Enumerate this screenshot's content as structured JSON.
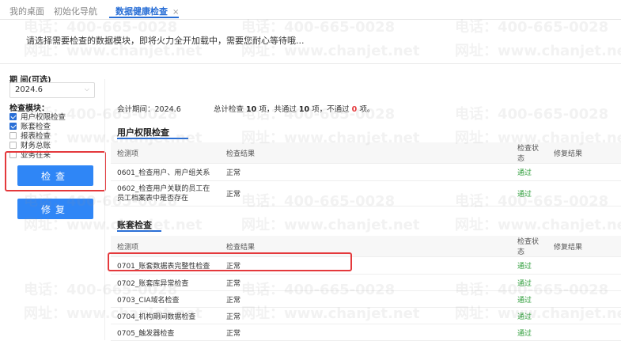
{
  "tabs": [
    {
      "label": "我的桌面"
    },
    {
      "label": "初始化导航"
    },
    {
      "label": "数据健康检查",
      "close": "×"
    }
  ],
  "instruction": "请选择需要检查的数据模块，即将火力全开加载中，需要您耐心等待哦...",
  "left": {
    "period_label": "期 间(可选)",
    "period_value": "2024.6",
    "module_label": "检查模块：",
    "modules": [
      {
        "label": "用户权限检查",
        "checked": true
      },
      {
        "label": "账套检查",
        "checked": true
      },
      {
        "label": "报表检查",
        "checked": false
      },
      {
        "label": "财务总账",
        "checked": false
      },
      {
        "label": "业务往来",
        "checked": false
      }
    ],
    "check_button": "检查",
    "repair_button": "修复"
  },
  "summary": {
    "period": "会计期间：2024.6",
    "p1": "总计检查",
    "total": "10",
    "p2": "项，共通过",
    "passed": "10",
    "p3": "项，不通过",
    "failed": "0",
    "p4": "项。"
  },
  "sections": [
    {
      "title": "用户权限检查",
      "headers": [
        "检测项",
        "检查结果",
        "检查状态",
        "修复结果"
      ],
      "rows": [
        {
          "item": "0601_检查用户、用户组关系",
          "result": "正常",
          "status": "通过",
          "fix": ""
        },
        {
          "item": "0602_检查用户关联的员工在员工档案表中是否存在",
          "result": "正常",
          "status": "通过",
          "fix": ""
        }
      ]
    },
    {
      "title": "账套检查",
      "headers": [
        "检测项",
        "检查结果",
        "检查状态",
        "修复结果"
      ],
      "rows": [
        {
          "item": "0701_账套数据表完整性检查",
          "result": "正常",
          "status": "通过",
          "fix": ""
        },
        {
          "item": "0702_账套库异常检查",
          "result": "正常",
          "status": "通过",
          "fix": ""
        },
        {
          "item": "0703_CIA域名检查",
          "result": "正常",
          "status": "通过",
          "fix": ""
        },
        {
          "item": "0704_机构期间数据检查",
          "result": "正常",
          "status": "通过",
          "fix": ""
        },
        {
          "item": "0705_触发器检查",
          "result": "正常",
          "status": "通过",
          "fix": ""
        }
      ]
    }
  ],
  "watermark": {
    "phone": "电话：400-665-0028",
    "site": "网址：www.chanjet.net"
  },
  "colors": {
    "accent": "#2f86f6",
    "highlight": "#e4393c",
    "pass": "#2e9d3a"
  }
}
